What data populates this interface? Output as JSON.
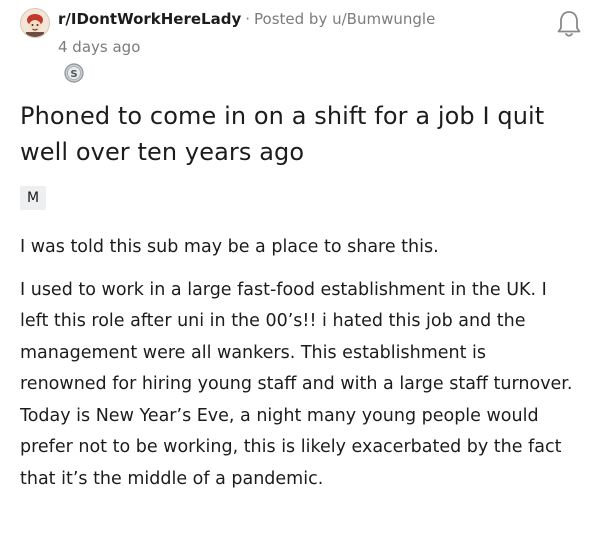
{
  "header": {
    "subreddit": "r/IDontWorkHereLady",
    "separator": "·",
    "posted_by_label": "Posted by",
    "author": "u/Bumwungle",
    "timestamp": "4 days ago",
    "avatar_icon": "subreddit-avatar-icon",
    "bell_icon": "notification-bell-icon",
    "award_icon": "silver-award-icon",
    "award_letter": "S"
  },
  "post": {
    "title": "Phoned to come in on a shift for a job I quit well over ten years ago",
    "flair": "M",
    "paragraphs": [
      "I was told this sub may be a place to share this.",
      "I used to work in a large fast-food establishment in the UK. I left this role after uni in the 00’s!! i hated this job and the management were all wankers. This establishment is renowned for hiring young staff and with a large staff turnover. Today is New Year’s Eve, a night many young people would prefer not to be working, this is likely exacerbated by the fact that it’s the middle of a pandemic."
    ]
  },
  "colors": {
    "text": "#1c1c1c",
    "meta": "#7c7c7c",
    "flair_bg": "#edeff1"
  }
}
